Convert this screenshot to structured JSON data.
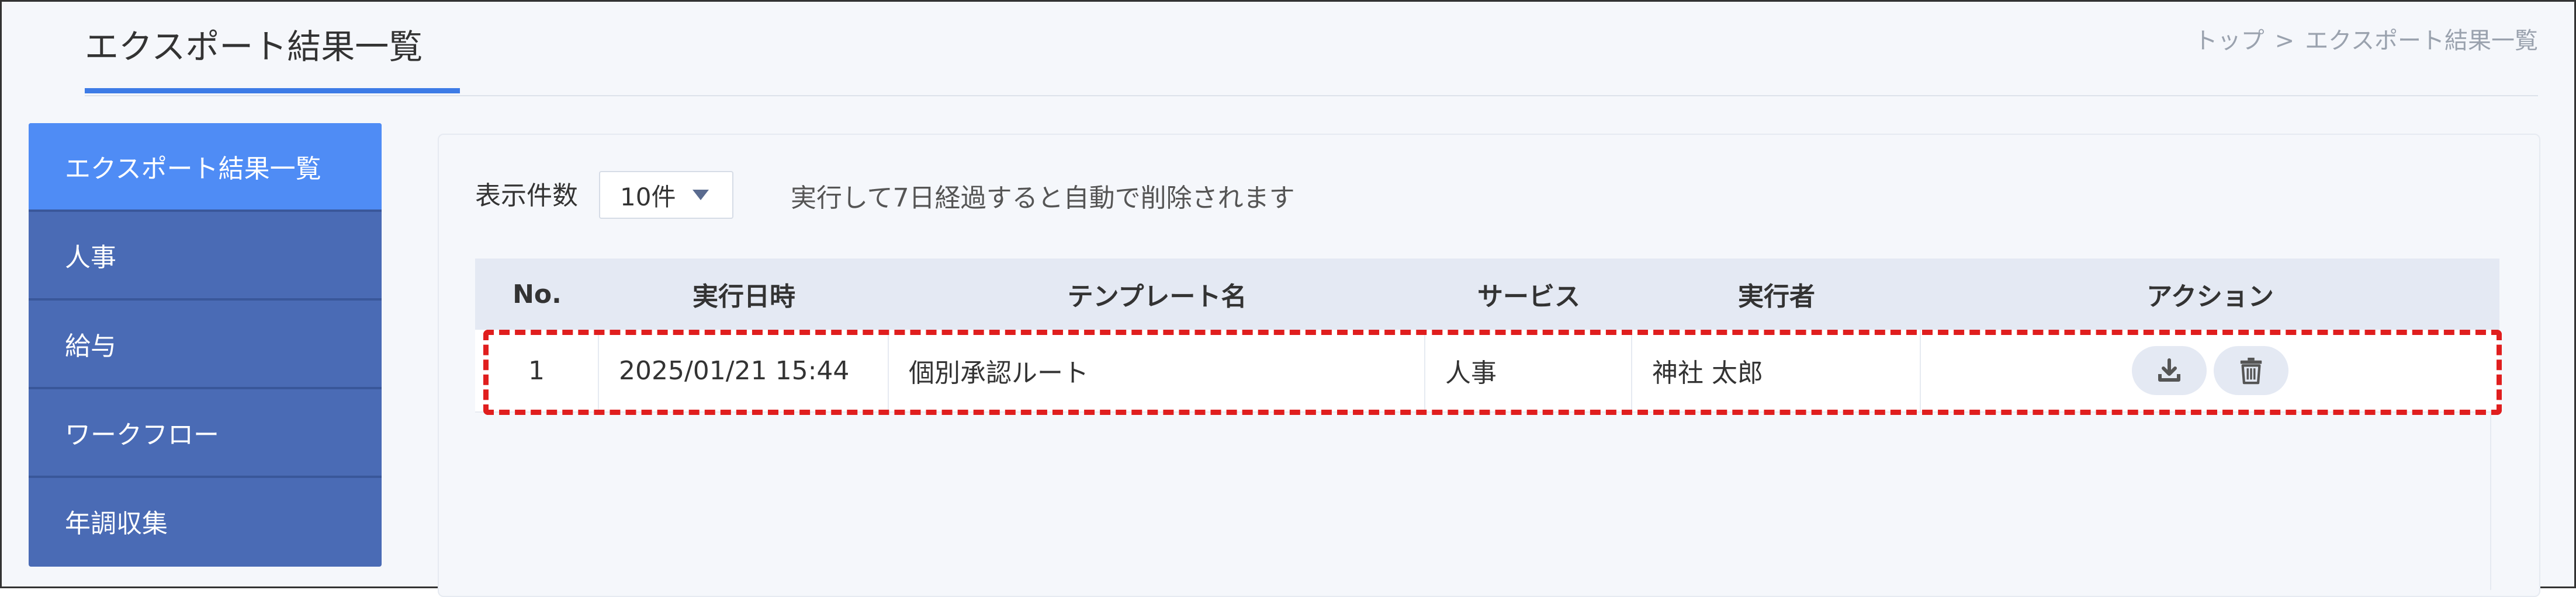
{
  "header": {
    "title": "エクスポート結果一覧",
    "breadcrumb": [
      "トップ",
      "エクスポート結果一覧"
    ],
    "breadcrumb_separator": ">"
  },
  "sidebar": {
    "items": [
      {
        "label": "エクスポート結果一覧",
        "active": true
      },
      {
        "label": "人事",
        "active": false
      },
      {
        "label": "給与",
        "active": false
      },
      {
        "label": "ワークフロー",
        "active": false
      },
      {
        "label": "年調収集",
        "active": false
      }
    ]
  },
  "controls": {
    "page_size_label": "表示件数",
    "page_size_value": "10件",
    "retention_note": "実行して7日経過すると自動で削除されます"
  },
  "table": {
    "columns": [
      "No.",
      "実行日時",
      "テンプレート名",
      "サービス",
      "実行者",
      "アクション"
    ],
    "rows": [
      {
        "no": "1",
        "executed_at": "2025/01/21 15:44",
        "template": "個別承認ルート",
        "service": "人事",
        "executor": "神社 太郎",
        "actions": [
          "download-icon",
          "trash-icon"
        ]
      }
    ]
  },
  "colors": {
    "accent": "#3d7be6",
    "sidebar_bg": "#4a6bb5",
    "sidebar_active": "#4f8cf5",
    "highlight": "#e01e1e"
  }
}
